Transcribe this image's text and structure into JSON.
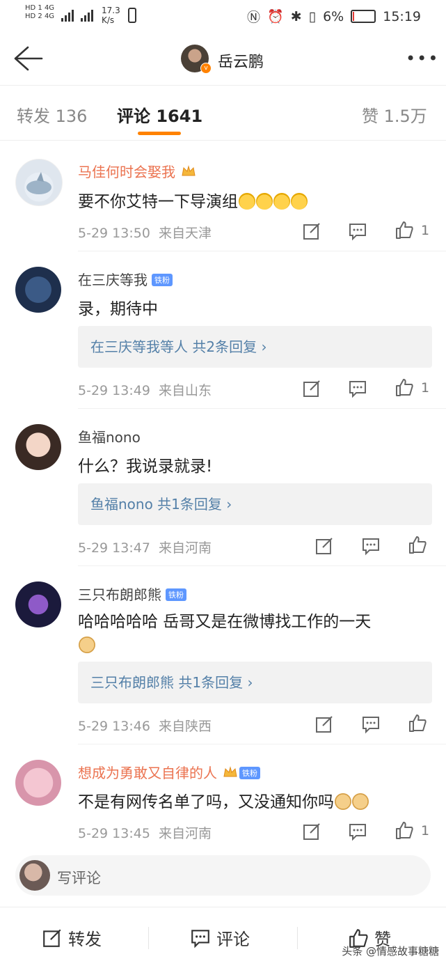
{
  "status": {
    "sim1": "HD 1  4G",
    "sim2": "HD 2  4G",
    "speed_value": "17.3",
    "speed_unit": "K/s",
    "battery": "6%",
    "time": "15:19",
    "battery_level": 0.06
  },
  "header": {
    "title": "岳云鹏",
    "more_label": "•••"
  },
  "tabs": {
    "repost": "转发 136",
    "comments": "评论 1641",
    "likes": "赞 1.5万"
  },
  "comments": [
    {
      "user": "马佳何时会娶我",
      "text": "要不你艾特一下导演组",
      "emojis": [
        "cry",
        "cry",
        "cry",
        "cry"
      ],
      "time": "5-29 13:50",
      "source": "来自天津",
      "likes": "1",
      "reply": ""
    },
    {
      "user": "在三庆等我",
      "badge": "铁粉",
      "text": "录，期待中",
      "time": "5-29 13:49",
      "source": "来自山东",
      "likes": "1",
      "reply": "在三庆等我等人  共2条回复 ›"
    },
    {
      "user": "鱼福nono",
      "text": "什么？我说录就录!",
      "time": "5-29 13:47",
      "source": "来自河南",
      "likes": "",
      "reply": "鱼福nono  共1条回复 ›"
    },
    {
      "user": "三只布朗郎熊",
      "badge": "铁粉",
      "text": "哈哈哈哈哈 岳哥又是在微博找工作的一天",
      "time": "5-29 13:46",
      "source": "来自陕西",
      "likes": "",
      "reply": "三只布朗郎熊  共1条回复 ›"
    },
    {
      "user": "想成为勇敢又自律的人",
      "badge": "铁粉",
      "text": "不是有网传名单了吗，又没通知你吗",
      "time": "5-29 13:45",
      "source": "来自河南",
      "likes": "1",
      "reply": ""
    }
  ],
  "write_comment": "写评论",
  "bottom": {
    "repost": "转发",
    "comment": "评论",
    "like": "赞"
  },
  "watermark": "头条 @情感故事糖糖"
}
